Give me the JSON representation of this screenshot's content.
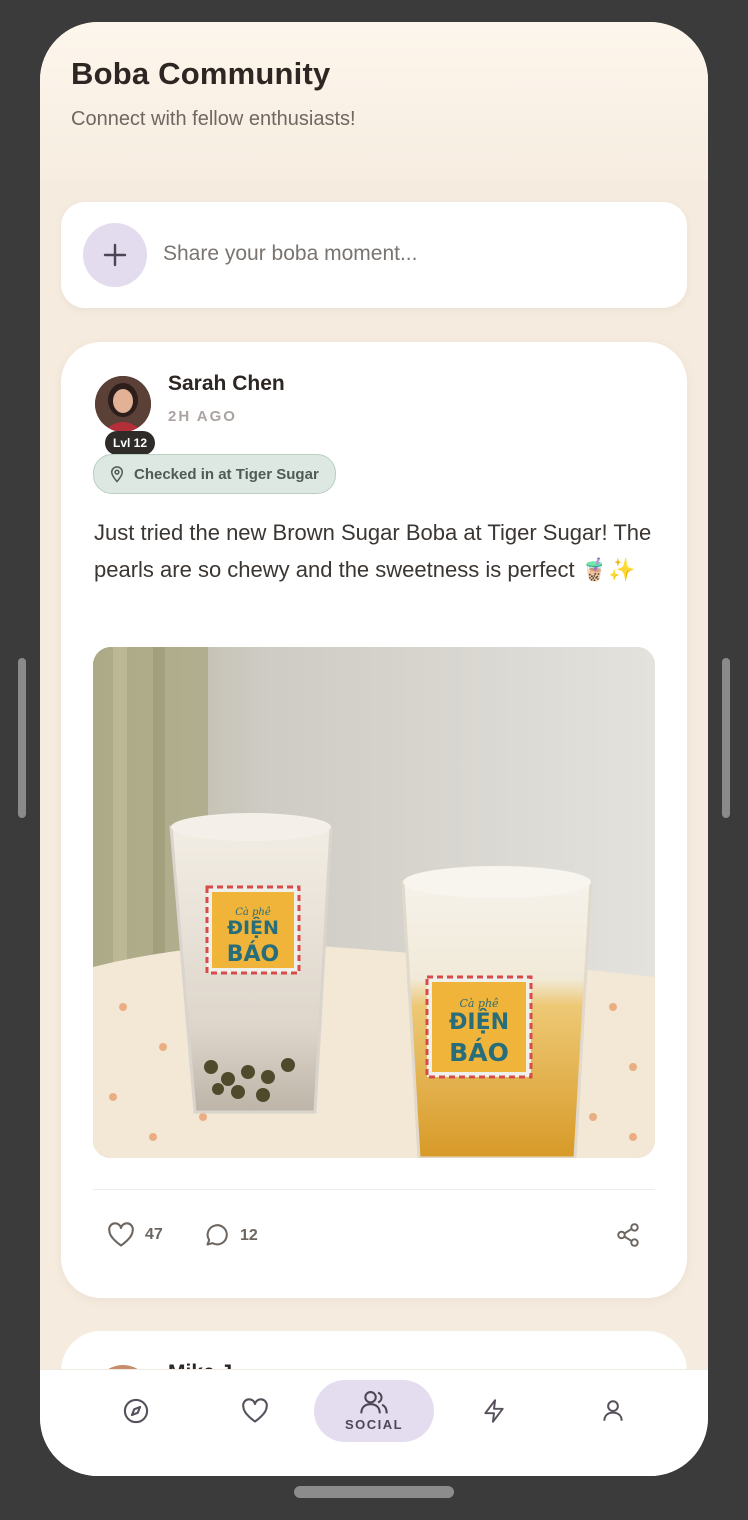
{
  "header": {
    "title": "Boba Community",
    "subtitle": "Connect with fellow enthusiasts!"
  },
  "composer": {
    "placeholder": "Share your boba moment...",
    "add_icon": "plus-icon"
  },
  "post": {
    "author": "Sarah Chen",
    "level": "Lvl 12",
    "time": "2H AGO",
    "checkin": "Checked in at Tiger Sugar",
    "text": "Just tried the new Brown Sugar Boba at Tiger Sugar! The pearls are so chewy and the sweetness is perfect 🧋✨",
    "image": {
      "label_line1": "Cà phê",
      "label_line2": "ĐIỆN",
      "label_line3": "BÁO"
    },
    "likes": "47",
    "comments": "12"
  },
  "next_post": {
    "author": "Mike J..."
  },
  "tabbar": {
    "items": [
      {
        "name": "explore",
        "icon": "compass-icon",
        "label": ""
      },
      {
        "name": "favorites",
        "icon": "heart-icon",
        "label": ""
      },
      {
        "name": "social",
        "icon": "users-icon",
        "label": "SOCIAL"
      },
      {
        "name": "activity",
        "icon": "lightning-icon",
        "label": ""
      },
      {
        "name": "profile",
        "icon": "user-icon",
        "label": ""
      }
    ],
    "active": "social"
  },
  "colors": {
    "background": "#f5ecdf",
    "accent": "#e4ddf0",
    "checkin": "#dce8e1"
  }
}
